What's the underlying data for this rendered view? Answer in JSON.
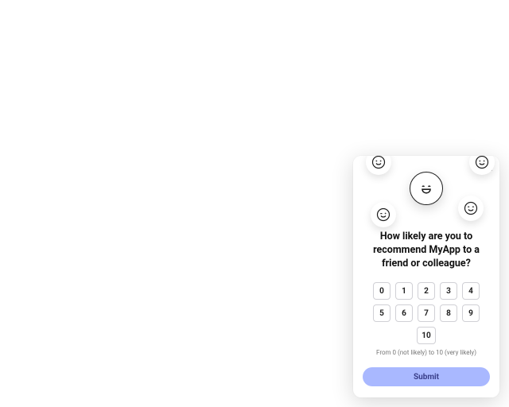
{
  "survey": {
    "question": "How likely are you to recommend MyApp to a friend or colleague?",
    "legend": "From 0 (not likely) to 10 (very likely)",
    "options": [
      "0",
      "1",
      "2",
      "3",
      "4",
      "5",
      "6",
      "7",
      "8",
      "9",
      "10"
    ],
    "submit_label": "Submit",
    "hero_icon": "laugh-icon",
    "float_icons": [
      "smile-icon",
      "smile-icon",
      "wink-icon",
      "blush-icon"
    ]
  }
}
